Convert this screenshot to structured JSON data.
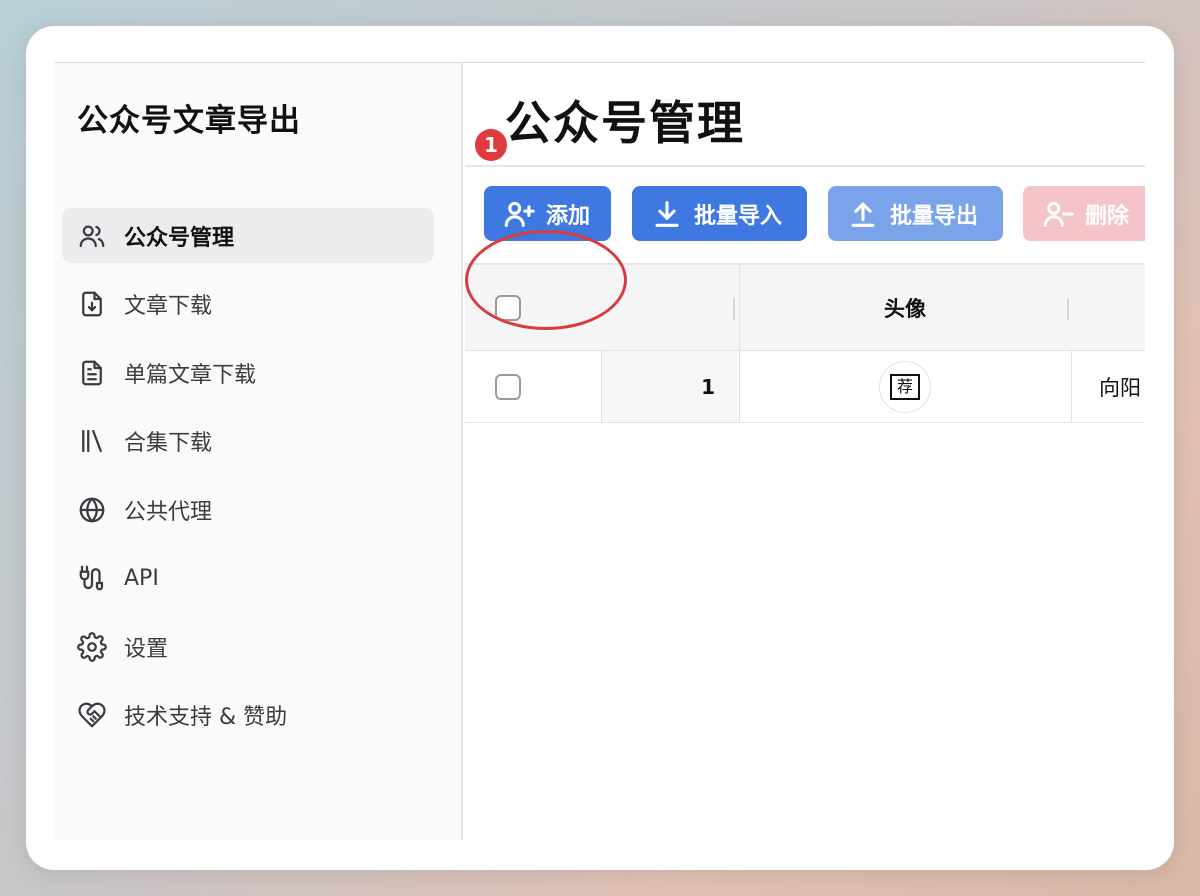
{
  "sidebar": {
    "title": "公众号文章导出",
    "items": [
      {
        "label": "公众号管理",
        "icon": "users-icon",
        "active": true
      },
      {
        "label": "文章下载",
        "icon": "file-download-icon",
        "active": false
      },
      {
        "label": "单篇文章下载",
        "icon": "file-text-icon",
        "active": false
      },
      {
        "label": "合集下载",
        "icon": "library-icon",
        "active": false
      },
      {
        "label": "公共代理",
        "icon": "globe-icon",
        "active": false
      },
      {
        "label": "API",
        "icon": "plug-icon",
        "active": false
      },
      {
        "label": "设置",
        "icon": "gear-icon",
        "active": false
      },
      {
        "label": "技术支持 & 赞助",
        "icon": "heart-handshake-icon",
        "active": false
      }
    ]
  },
  "main": {
    "title": "公众号管理",
    "badge": "1",
    "toolbar": {
      "add": "添加",
      "import": "批量导入",
      "export": "批量导出",
      "delete": "删除"
    },
    "table": {
      "headers": {
        "avatar": "头像"
      },
      "rows": [
        {
          "index": "1",
          "avatar_char": "荐",
          "name": "向阳"
        }
      ]
    }
  },
  "colors": {
    "primary": "#3f78e0",
    "primary_light": "#7aa3ea",
    "danger_light": "#f4c4c9",
    "badge": "#e0393e",
    "annotation_ring": "#d93c3c"
  }
}
